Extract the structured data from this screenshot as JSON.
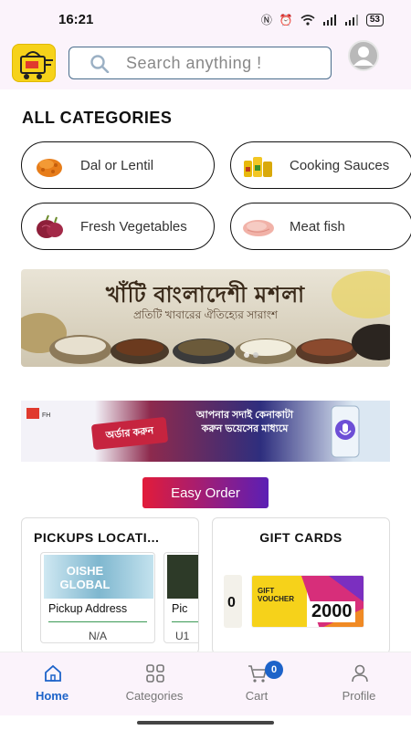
{
  "status": {
    "time": "16:21",
    "battery": "53"
  },
  "header": {
    "search_placeholder": "Search anything !"
  },
  "categories": {
    "title": "ALL CATEGORIES",
    "items": [
      {
        "label": "Dal or Lentil",
        "icon": "lentil-image"
      },
      {
        "label": "Cooking Sauces",
        "icon": "oil-bottles-image"
      },
      {
        "label": "Fresh Vegetables",
        "icon": "onion-image"
      },
      {
        "label": "Meat fish",
        "icon": "meat-image"
      }
    ]
  },
  "banner1": {
    "title": "খাঁটি বাংলাদেশী মশলা",
    "subtitle": "প্রতিটি খাবারের ঐতিহ্যের সারাংশ"
  },
  "banner2": {
    "text": "আপনার সদাই কেনাকাটা করুন ভয়েসের মাধ্যমে",
    "badge": "অর্ডার করুন"
  },
  "easy_order": {
    "label": "Easy Order"
  },
  "pickups": {
    "title": "PICKUPS LOCATI...",
    "items": [
      {
        "image_text": "OISHE GLOBAL",
        "label": "Pickup Address",
        "value": "N/A"
      },
      {
        "image_text": "",
        "label": "Pic",
        "value": "U1"
      }
    ]
  },
  "gift_cards": {
    "title": "GIFT CARDS",
    "voucher_title": "GIFT VOUCHER",
    "amount": "2000",
    "left_amount": "0"
  },
  "nav": {
    "items": [
      {
        "label": "Home",
        "icon": "home-icon",
        "active": true
      },
      {
        "label": "Categories",
        "icon": "grid-icon"
      },
      {
        "label": "Cart",
        "icon": "cart-icon",
        "badge": "0"
      },
      {
        "label": "Profile",
        "icon": "person-icon"
      }
    ]
  },
  "colors": {
    "accent": "#1d63c9",
    "topbar_bg": "#fbf3fb",
    "easy_order_start": "#e21c3a",
    "easy_order_end": "#5b1fb5"
  }
}
